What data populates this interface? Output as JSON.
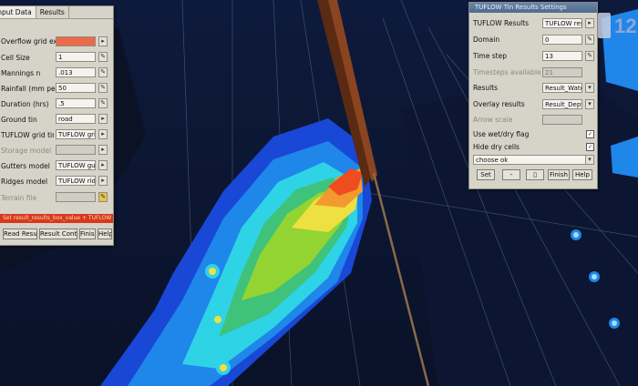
{
  "colors": {
    "background": "#0d1530",
    "warning_bar": "#d8391a",
    "field_swatch": "#ea6a49"
  },
  "left_panel": {
    "tabs": [
      "Input Data",
      "Results"
    ],
    "rows": [
      {
        "label": "Overflow grid extent",
        "value": ""
      },
      {
        "label": "Cell Size",
        "value": "1"
      },
      {
        "label": "Mannings n",
        "value": ".013"
      },
      {
        "label": "Rainfall (mm per hr)",
        "value": "50"
      },
      {
        "label": "Duration (hrs)",
        "value": ".5"
      },
      {
        "label": "Ground tin",
        "value": "road"
      },
      {
        "label": "TUFLOW grid tin model",
        "value": "TUFLOW grid tin"
      },
      {
        "label": "Storage model",
        "value": ""
      },
      {
        "label": "Gutters model",
        "value": "TUFLOW gullys"
      },
      {
        "label": "Ridges model",
        "value": "TUFLOW ridges"
      },
      {
        "label": "Terrain file",
        "value": ""
      }
    ],
    "warning": "Set result_results_box_value + TUFLOW tin",
    "buttons": [
      "Read Results",
      "Result Controls",
      "Finish",
      "Help"
    ]
  },
  "right_panel": {
    "title": "TUFLOW Tin Results Settings",
    "rows": [
      {
        "label": "TUFLOW Results",
        "value": "TUFLOW results tin",
        "disabled": false
      },
      {
        "label": "Domain",
        "value": "0",
        "disabled": false
      },
      {
        "label": "Time step",
        "value": "13",
        "disabled": false
      },
      {
        "label": "Timesteps available",
        "value": "21",
        "disabled": true
      },
      {
        "label": "Results",
        "value": "Result_Water_Level",
        "disabled": false
      },
      {
        "label": "Overlay results",
        "value": "Result_Depth",
        "disabled": false
      },
      {
        "label": "Arrow scale",
        "value": "",
        "disabled": true
      }
    ],
    "checks": [
      {
        "label": "Use wet/dry flag",
        "checked": true
      },
      {
        "label": "Hide dry cells",
        "checked": true
      }
    ],
    "message": "choose ok",
    "buttons": [
      "Set",
      "-",
      "",
      "Finish",
      "Help"
    ]
  },
  "corner_badge": "12"
}
